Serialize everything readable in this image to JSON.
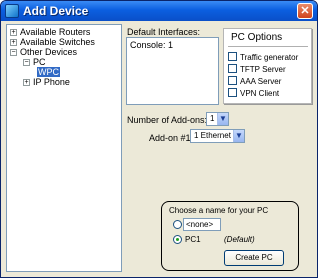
{
  "window": {
    "title": "Add Device"
  },
  "tree": {
    "items": [
      {
        "label": "Available Routers",
        "expander": "+"
      },
      {
        "label": "Available Switches",
        "expander": "+"
      },
      {
        "label": "Other Devices",
        "expander": "−"
      },
      {
        "label": "PC",
        "expander": "−"
      },
      {
        "label": "WPC",
        "selected": true
      },
      {
        "label": "IP Phone",
        "expander": "+"
      }
    ]
  },
  "interfaces": {
    "label": "Default Interfaces:",
    "items": [
      "Console: 1"
    ]
  },
  "pc_options": {
    "title": "PC Options",
    "options": [
      {
        "label": "Traffic generator",
        "checked": false
      },
      {
        "label": "TFTP Server",
        "checked": false
      },
      {
        "label": "AAA Server",
        "checked": false
      },
      {
        "label": "VPN Client",
        "checked": false
      }
    ]
  },
  "addons": {
    "count_label": "Number of Add-ons:",
    "count_value": "1",
    "addon1_label": "Add-on #1",
    "addon1_value": "1 Ethernet"
  },
  "name_box": {
    "title": "Choose a name for your PC",
    "custom_value": "<none>",
    "default_name": "PC1",
    "default_note": "(Default)",
    "selected": "default",
    "create_button": "Create PC"
  },
  "colors": {
    "titlebar": "#0b5fe0",
    "selection": "#316ac5",
    "close": "#d0431c"
  }
}
